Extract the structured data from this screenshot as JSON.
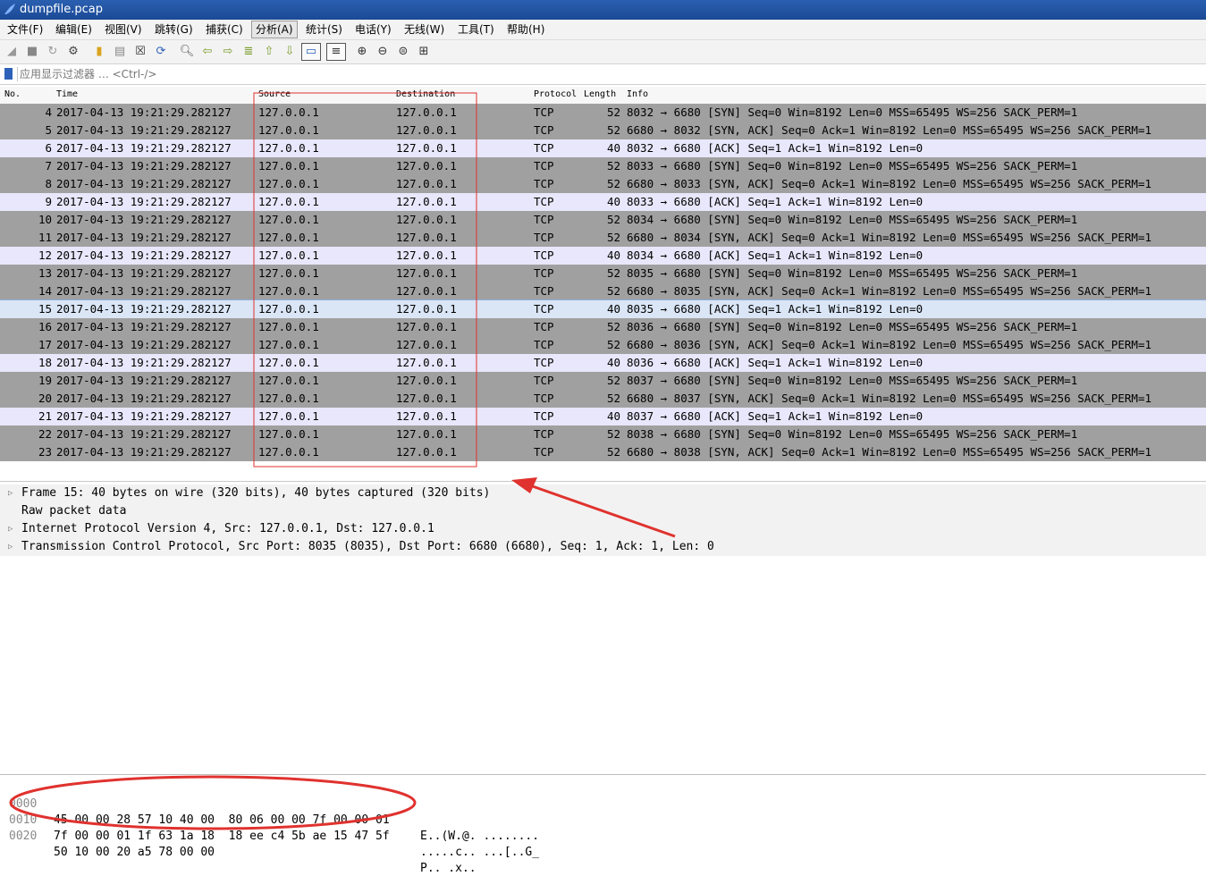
{
  "window": {
    "title": "dumpfile.pcap"
  },
  "menu": [
    {
      "label": "文件(F)"
    },
    {
      "label": "编辑(E)"
    },
    {
      "label": "视图(V)"
    },
    {
      "label": "跳转(G)"
    },
    {
      "label": "捕获(C)"
    },
    {
      "label": "分析(A)"
    },
    {
      "label": "统计(S)"
    },
    {
      "label": "电话(Y)"
    },
    {
      "label": "无线(W)"
    },
    {
      "label": "工具(T)"
    },
    {
      "label": "帮助(H)"
    }
  ],
  "filter": {
    "placeholder": "应用显示过滤器 … <Ctrl-/>"
  },
  "columns": {
    "no": "No.",
    "time": "Time",
    "source": "Source",
    "destination": "Destination",
    "protocol": "Protocol",
    "length": "Length",
    "info": "Info"
  },
  "packets": [
    {
      "no": "4",
      "time": "2017-04-13 19:21:29.282127",
      "src": "127.0.0.1",
      "dst": "127.0.0.1",
      "proto": "TCP",
      "len": "52",
      "info": "8032 → 6680 [SYN] Seq=0 Win=8192 Len=0 MSS=65495 WS=256 SACK_PERM=1"
    },
    {
      "no": "5",
      "time": "2017-04-13 19:21:29.282127",
      "src": "127.0.0.1",
      "dst": "127.0.0.1",
      "proto": "TCP",
      "len": "52",
      "info": "6680 → 8032 [SYN, ACK] Seq=0 Ack=1 Win=8192 Len=0 MSS=65495 WS=256 SACK_PERM=1"
    },
    {
      "no": "6",
      "time": "2017-04-13 19:21:29.282127",
      "src": "127.0.0.1",
      "dst": "127.0.0.1",
      "proto": "TCP",
      "len": "40",
      "info": "8032 → 6680 [ACK] Seq=1 Ack=1 Win=8192 Len=0"
    },
    {
      "no": "7",
      "time": "2017-04-13 19:21:29.282127",
      "src": "127.0.0.1",
      "dst": "127.0.0.1",
      "proto": "TCP",
      "len": "52",
      "info": "8033 → 6680 [SYN] Seq=0 Win=8192 Len=0 MSS=65495 WS=256 SACK_PERM=1"
    },
    {
      "no": "8",
      "time": "2017-04-13 19:21:29.282127",
      "src": "127.0.0.1",
      "dst": "127.0.0.1",
      "proto": "TCP",
      "len": "52",
      "info": "6680 → 8033 [SYN, ACK] Seq=0 Ack=1 Win=8192 Len=0 MSS=65495 WS=256 SACK_PERM=1"
    },
    {
      "no": "9",
      "time": "2017-04-13 19:21:29.282127",
      "src": "127.0.0.1",
      "dst": "127.0.0.1",
      "proto": "TCP",
      "len": "40",
      "info": "8033 → 6680 [ACK] Seq=1 Ack=1 Win=8192 Len=0"
    },
    {
      "no": "10",
      "time": "2017-04-13 19:21:29.282127",
      "src": "127.0.0.1",
      "dst": "127.0.0.1",
      "proto": "TCP",
      "len": "52",
      "info": "8034 → 6680 [SYN] Seq=0 Win=8192 Len=0 MSS=65495 WS=256 SACK_PERM=1"
    },
    {
      "no": "11",
      "time": "2017-04-13 19:21:29.282127",
      "src": "127.0.0.1",
      "dst": "127.0.0.1",
      "proto": "TCP",
      "len": "52",
      "info": "6680 → 8034 [SYN, ACK] Seq=0 Ack=1 Win=8192 Len=0 MSS=65495 WS=256 SACK_PERM=1"
    },
    {
      "no": "12",
      "time": "2017-04-13 19:21:29.282127",
      "src": "127.0.0.1",
      "dst": "127.0.0.1",
      "proto": "TCP",
      "len": "40",
      "info": "8034 → 6680 [ACK] Seq=1 Ack=1 Win=8192 Len=0"
    },
    {
      "no": "13",
      "time": "2017-04-13 19:21:29.282127",
      "src": "127.0.0.1",
      "dst": "127.0.0.1",
      "proto": "TCP",
      "len": "52",
      "info": "8035 → 6680 [SYN] Seq=0 Win=8192 Len=0 MSS=65495 WS=256 SACK_PERM=1"
    },
    {
      "no": "14",
      "time": "2017-04-13 19:21:29.282127",
      "src": "127.0.0.1",
      "dst": "127.0.0.1",
      "proto": "TCP",
      "len": "52",
      "info": "6680 → 8035 [SYN, ACK] Seq=0 Ack=1 Win=8192 Len=0 MSS=65495 WS=256 SACK_PERM=1"
    },
    {
      "no": "15",
      "time": "2017-04-13 19:21:29.282127",
      "src": "127.0.0.1",
      "dst": "127.0.0.1",
      "proto": "TCP",
      "len": "40",
      "info": "8035 → 6680 [ACK] Seq=1 Ack=1 Win=8192 Len=0"
    },
    {
      "no": "16",
      "time": "2017-04-13 19:21:29.282127",
      "src": "127.0.0.1",
      "dst": "127.0.0.1",
      "proto": "TCP",
      "len": "52",
      "info": "8036 → 6680 [SYN] Seq=0 Win=8192 Len=0 MSS=65495 WS=256 SACK_PERM=1"
    },
    {
      "no": "17",
      "time": "2017-04-13 19:21:29.282127",
      "src": "127.0.0.1",
      "dst": "127.0.0.1",
      "proto": "TCP",
      "len": "52",
      "info": "6680 → 8036 [SYN, ACK] Seq=0 Ack=1 Win=8192 Len=0 MSS=65495 WS=256 SACK_PERM=1"
    },
    {
      "no": "18",
      "time": "2017-04-13 19:21:29.282127",
      "src": "127.0.0.1",
      "dst": "127.0.0.1",
      "proto": "TCP",
      "len": "40",
      "info": "8036 → 6680 [ACK] Seq=1 Ack=1 Win=8192 Len=0"
    },
    {
      "no": "19",
      "time": "2017-04-13 19:21:29.282127",
      "src": "127.0.0.1",
      "dst": "127.0.0.1",
      "proto": "TCP",
      "len": "52",
      "info": "8037 → 6680 [SYN] Seq=0 Win=8192 Len=0 MSS=65495 WS=256 SACK_PERM=1"
    },
    {
      "no": "20",
      "time": "2017-04-13 19:21:29.282127",
      "src": "127.0.0.1",
      "dst": "127.0.0.1",
      "proto": "TCP",
      "len": "52",
      "info": "6680 → 8037 [SYN, ACK] Seq=0 Ack=1 Win=8192 Len=0 MSS=65495 WS=256 SACK_PERM=1"
    },
    {
      "no": "21",
      "time": "2017-04-13 19:21:29.282127",
      "src": "127.0.0.1",
      "dst": "127.0.0.1",
      "proto": "TCP",
      "len": "40",
      "info": "8037 → 6680 [ACK] Seq=1 Ack=1 Win=8192 Len=0"
    },
    {
      "no": "22",
      "time": "2017-04-13 19:21:29.282127",
      "src": "127.0.0.1",
      "dst": "127.0.0.1",
      "proto": "TCP",
      "len": "52",
      "info": "8038 → 6680 [SYN] Seq=0 Win=8192 Len=0 MSS=65495 WS=256 SACK_PERM=1"
    },
    {
      "no": "23",
      "time": "2017-04-13 19:21:29.282127",
      "src": "127.0.0.1",
      "dst": "127.0.0.1",
      "proto": "TCP",
      "len": "52",
      "info": "6680 → 8038 [SYN, ACK] Seq=0 Ack=1 Win=8192 Len=0 MSS=65495 WS=256 SACK_PERM=1"
    }
  ],
  "details": [
    {
      "text": "Frame 15: 40 bytes on wire (320 bits), 40 bytes captured (320 bits)"
    },
    {
      "text": "Raw packet data"
    },
    {
      "text": "Internet Protocol Version 4, Src: 127.0.0.1, Dst: 127.0.0.1"
    },
    {
      "text": "Transmission Control Protocol, Src Port: 8035 (8035), Dst Port: 6680 (6680), Seq: 1, Ack: 1, Len: 0"
    }
  ],
  "bytes": [
    {
      "offset": "0000",
      "hex": "45 00 00 28 57 10 40 00  80 06 00 00 7f 00 00 01",
      "ascii": "E..(W.@. ........"
    },
    {
      "offset": "0010",
      "hex": "7f 00 00 01 1f 63 1a 18  18 ee c4 5b ae 15 47 5f",
      "ascii": ".....c.. ...[..G_"
    },
    {
      "offset": "0020",
      "hex": "50 10 00 20 a5 78 00 00",
      "ascii": "P.. .x.."
    }
  ],
  "colors": {
    "row_gray": "#a0a0a0",
    "row_lavender": "#e8e7fb",
    "row_selected": "#dae5f5",
    "annotation_red": "#e0322e"
  }
}
